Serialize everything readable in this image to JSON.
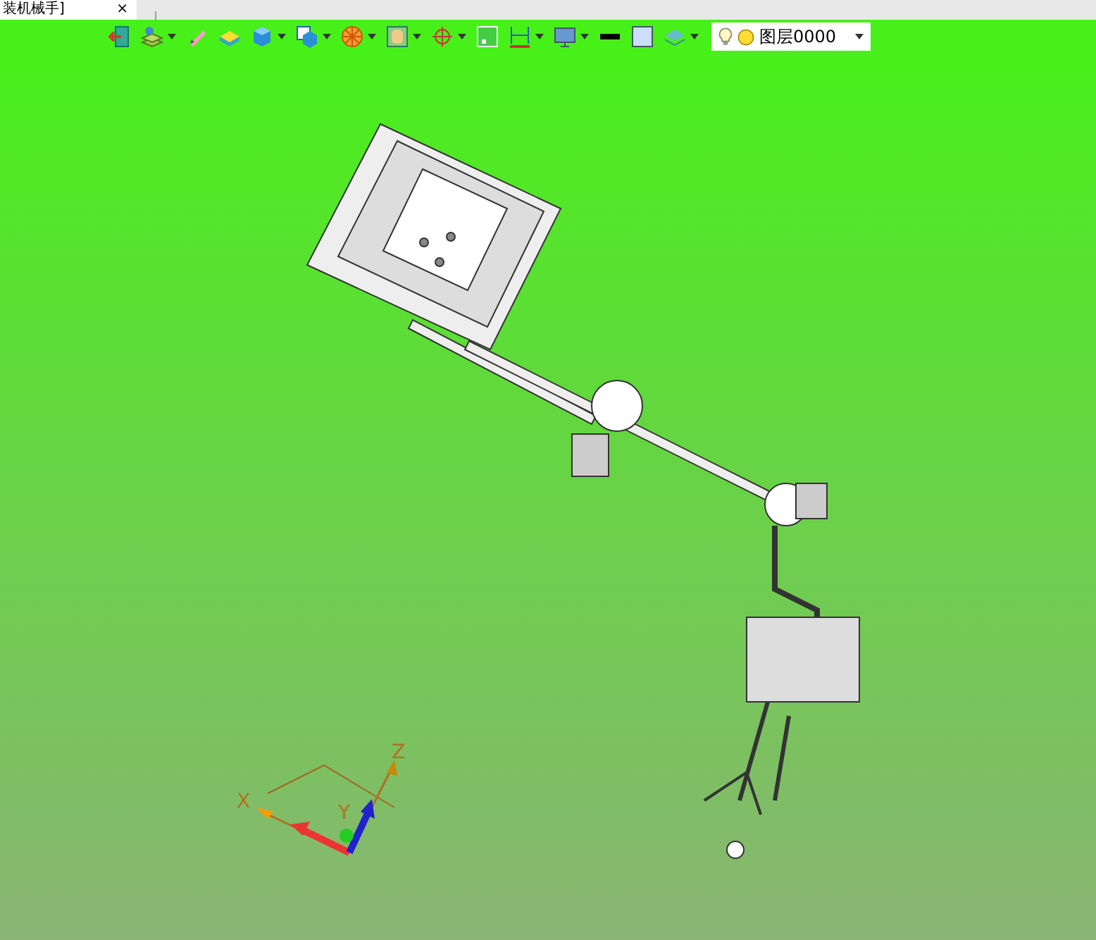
{
  "document_tab": {
    "title": "装机械手]",
    "close": "×"
  },
  "toolbar": [
    {
      "kind": "exit",
      "dropdown": false
    },
    {
      "kind": "layers",
      "dropdown": true
    },
    {
      "kind": "pencil",
      "dropdown": false
    },
    {
      "kind": "slab",
      "dropdown": false
    },
    {
      "kind": "cube",
      "dropdown": true
    },
    {
      "kind": "view",
      "dropdown": true
    },
    {
      "kind": "wheel",
      "dropdown": true
    },
    {
      "kind": "frame",
      "dropdown": true
    },
    {
      "kind": "target",
      "dropdown": true
    },
    {
      "kind": "dot",
      "dropdown": false
    },
    {
      "kind": "dimension",
      "dropdown": true
    },
    {
      "kind": "monitor",
      "dropdown": true
    },
    {
      "kind": "line",
      "dropdown": false
    },
    {
      "kind": "fill",
      "dropdown": false
    },
    {
      "kind": "stack",
      "dropdown": true
    }
  ],
  "layer_select": {
    "value": "图层0000"
  },
  "axis_triad": {
    "x_label": "X",
    "y_label": "Y",
    "z_label": "Z"
  }
}
